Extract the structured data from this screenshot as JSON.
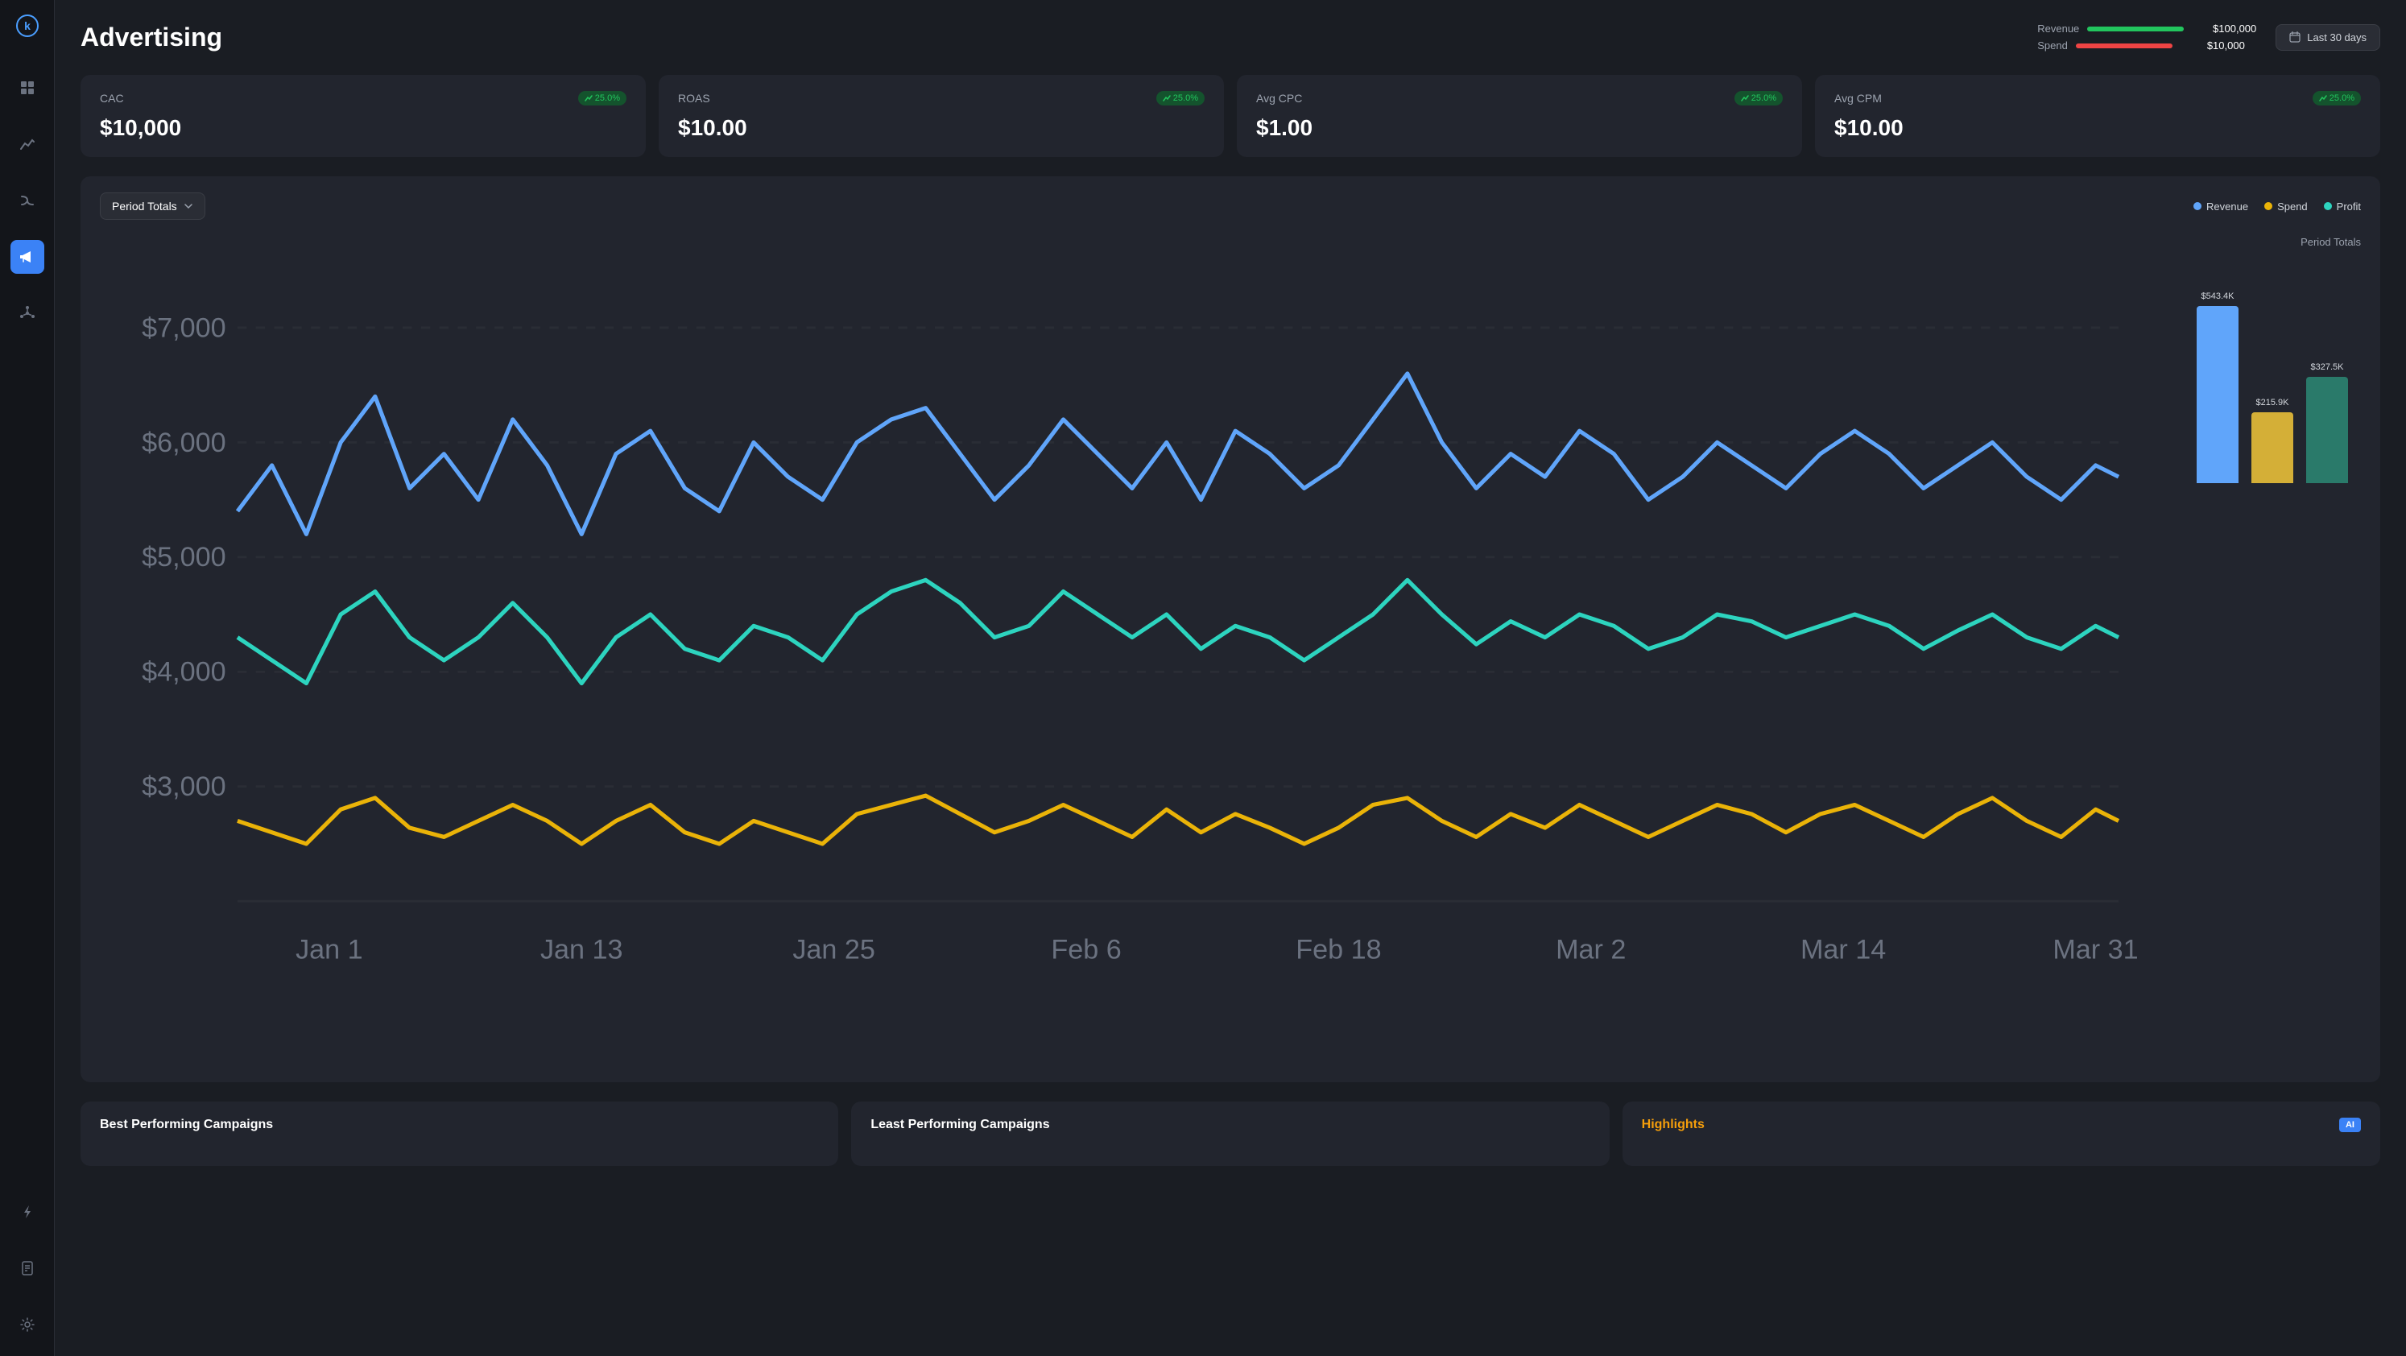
{
  "app": {
    "logo": "k",
    "title": "Advertising"
  },
  "sidebar": {
    "items": [
      {
        "id": "grid",
        "icon": "⊞",
        "label": "dashboard",
        "active": false
      },
      {
        "id": "chart",
        "icon": "📈",
        "label": "analytics",
        "active": false
      },
      {
        "id": "flow",
        "icon": "↯",
        "label": "flows",
        "active": false
      },
      {
        "id": "megaphone",
        "icon": "📢",
        "label": "advertising",
        "active": true
      },
      {
        "id": "asterisk",
        "icon": "✳",
        "label": "integrations",
        "active": false
      },
      {
        "id": "bolt",
        "icon": "⚡",
        "label": "automations",
        "active": false
      },
      {
        "id": "report",
        "icon": "📋",
        "label": "reports",
        "active": false
      },
      {
        "id": "settings",
        "icon": "⚙",
        "label": "settings",
        "active": false
      }
    ]
  },
  "header": {
    "title": "Advertising",
    "revenue_label": "Revenue",
    "spend_label": "Spend",
    "revenue_value": "$100,000",
    "spend_value": "$10,000",
    "date_filter": "Last 30 days"
  },
  "kpis": [
    {
      "id": "cac",
      "label": "CAC",
      "value": "$10,000",
      "badge": "25.0%"
    },
    {
      "id": "roas",
      "label": "ROAS",
      "value": "$10.00",
      "badge": "25.0%"
    },
    {
      "id": "avg_cpc",
      "label": "Avg CPC",
      "value": "$1.00",
      "badge": "25.0%"
    },
    {
      "id": "avg_cpm",
      "label": "Avg CPM",
      "value": "$10.00",
      "badge": "25.0%"
    }
  ],
  "chart": {
    "dropdown_label": "Period Totals",
    "legend": [
      {
        "key": "revenue",
        "label": "Revenue",
        "color": "#60a5fa",
        "dot_class": "dot-blue"
      },
      {
        "key": "spend",
        "label": "Spend",
        "color": "#eab308",
        "dot_class": "dot-yellow"
      },
      {
        "key": "profit",
        "label": "Profit",
        "color": "#2dd4bf",
        "dot_class": "dot-teal"
      }
    ],
    "x_labels": [
      "Jan 1",
      "Jan 13",
      "Jan 25",
      "Feb 6",
      "Feb 18",
      "Mar 2",
      "Mar 14",
      "Mar 31"
    ],
    "y_labels": [
      "$7,000",
      "$6,000",
      "$5,000",
      "$4,000",
      "$3,000"
    ],
    "period_totals_title": "Period Totals",
    "bars": [
      {
        "label": "Revenue",
        "value": "$543.4K",
        "height_pct": 100,
        "color": "#60a5fa"
      },
      {
        "label": "Spend",
        "value": "$215.9K",
        "height_pct": 40,
        "color": "#d4af37"
      },
      {
        "label": "Profit",
        "value": "$327.5K",
        "height_pct": 60,
        "color": "#2a7a6a"
      }
    ]
  },
  "campaigns": {
    "best_title": "Best Performing Campaigns",
    "least_title": "Least Performing Campaigns",
    "highlights_title": "Highlights",
    "ai_label": "AI"
  }
}
